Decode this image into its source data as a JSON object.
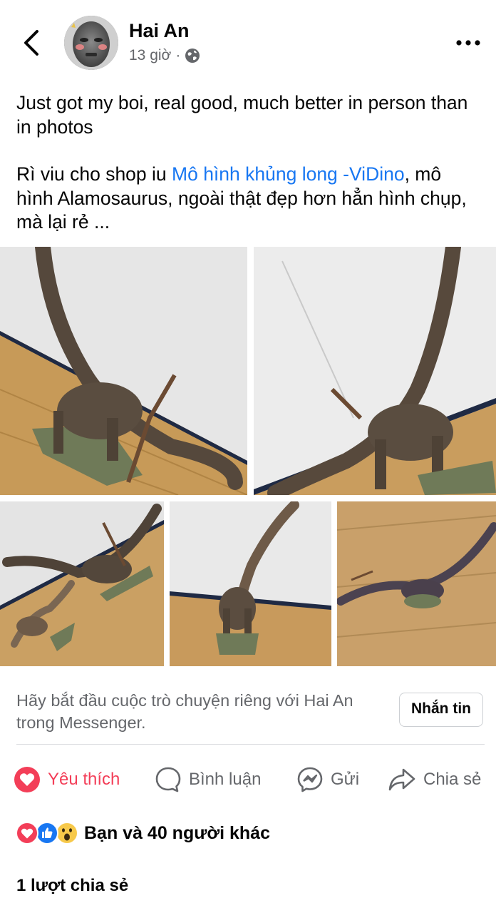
{
  "header": {
    "author": "Hai An",
    "time": "13 giờ",
    "separator": "·"
  },
  "post": {
    "paragraph1": "Just got my boi, real good, much better in person than in photos",
    "paragraph2_prefix": "Rì viu cho shop iu ",
    "paragraph2_link": "Mô hình khủng long -ViDino",
    "paragraph2_suffix": ", mô hình Alamosaurus, ngoài thật đẹp hơn hẳn hình chụp, mà lại rẻ ..."
  },
  "messenger": {
    "prompt": "Hãy bắt đầu cuộc trò chuyện riêng với Hai An trong Messenger.",
    "button": "Nhắn tin"
  },
  "actions": {
    "like": "Yêu thích",
    "comment": "Bình luận",
    "send": "Gửi",
    "share": "Chia sẻ"
  },
  "reactions": {
    "summary": "Bạn và 40 người khác",
    "icons": [
      "love-reaction-icon",
      "like-reaction-icon",
      "wow-reaction-icon"
    ]
  },
  "shares": {
    "count_text": "1 lượt chia sẻ"
  },
  "colors": {
    "accent_blue": "#1877f2",
    "love_red": "#f33e58",
    "secondary_text": "#65676b"
  }
}
